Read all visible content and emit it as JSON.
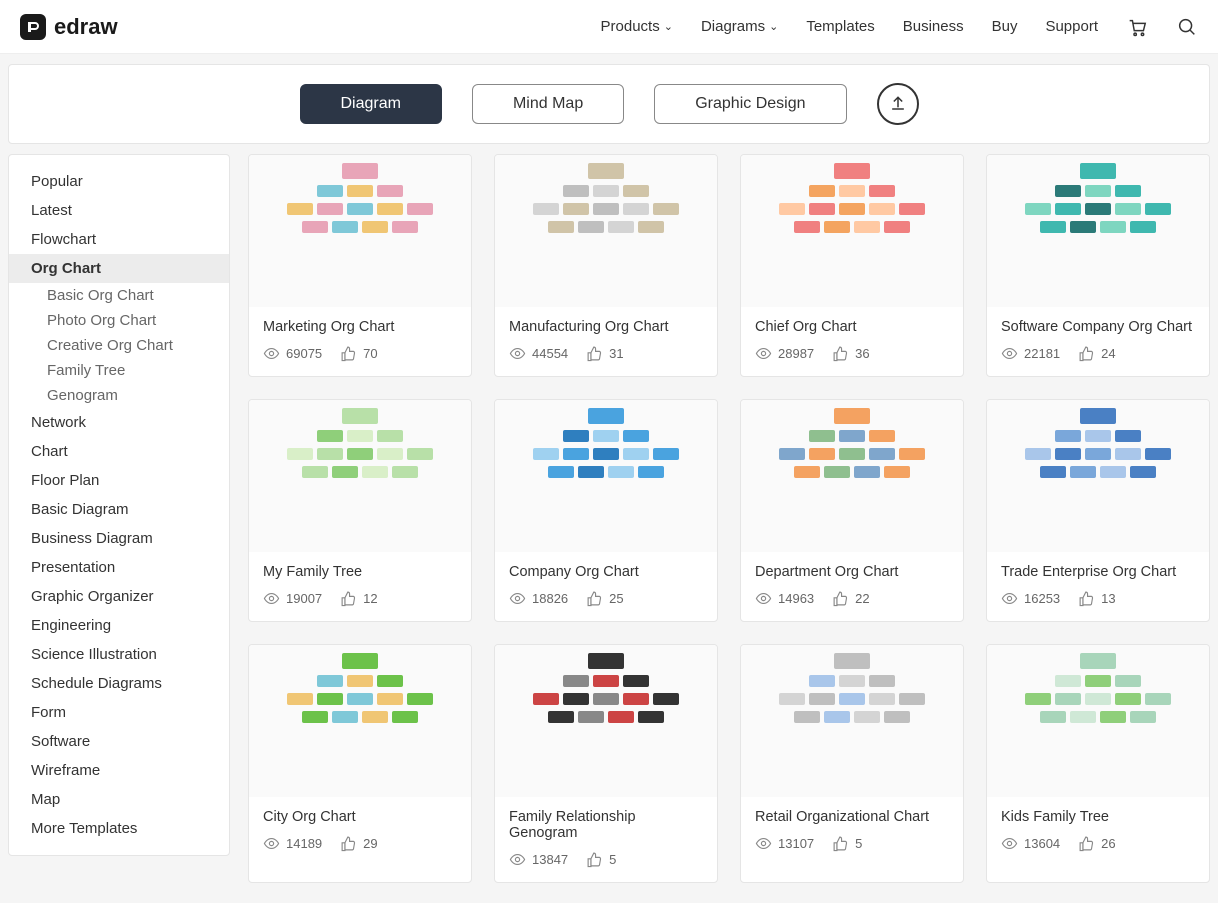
{
  "brand": {
    "name": "edraw"
  },
  "nav": {
    "items": [
      "Products",
      "Diagrams",
      "Templates",
      "Business",
      "Buy",
      "Support"
    ],
    "dropdown_flags": [
      true,
      true,
      false,
      false,
      false,
      false
    ]
  },
  "toolbar": {
    "tabs": [
      "Diagram",
      "Mind Map",
      "Graphic Design"
    ]
  },
  "sidebar": {
    "items": [
      "Popular",
      "Latest",
      "Flowchart",
      "Org Chart",
      "Network",
      "Chart",
      "Floor Plan",
      "Basic Diagram",
      "Business Diagram",
      "Presentation",
      "Graphic Organizer",
      "Engineering",
      "Science Illustration",
      "Schedule Diagrams",
      "Form",
      "Software",
      "Wireframe",
      "Map",
      "More Templates"
    ],
    "active_index": 3,
    "subitems": [
      "Basic Org Chart",
      "Photo Org Chart",
      "Creative Org Chart",
      "Family Tree",
      "Genogram"
    ]
  },
  "templates": [
    {
      "title": "Marketing Org Chart",
      "views": "69075",
      "likes": "70",
      "palette": [
        "#e8a5b8",
        "#7fc8d8",
        "#f0c674"
      ]
    },
    {
      "title": "Manufacturing Org Chart",
      "views": "44554",
      "likes": "31",
      "palette": [
        "#d0c4a8",
        "#bfbfbf",
        "#d4d4d4"
      ]
    },
    {
      "title": "Chief Org Chart",
      "views": "28987",
      "likes": "36",
      "palette": [
        "#f08080",
        "#f4a460",
        "#ffc9a3"
      ]
    },
    {
      "title": "Software Company Org Chart",
      "views": "22181",
      "likes": "24",
      "palette": [
        "#3fb8af",
        "#2b7a78",
        "#7ed6c0"
      ]
    },
    {
      "title": "My Family Tree",
      "views": "19007",
      "likes": "12",
      "palette": [
        "#b8e0a8",
        "#8fcf7a",
        "#d9efc8"
      ]
    },
    {
      "title": "Company Org Chart",
      "views": "18826",
      "likes": "25",
      "palette": [
        "#4aa3df",
        "#2f7fbf",
        "#9fd1f0"
      ]
    },
    {
      "title": "Department Org Chart",
      "views": "14963",
      "likes": "22",
      "palette": [
        "#f4a261",
        "#8fbf8f",
        "#7fa6cc"
      ]
    },
    {
      "title": "Trade Enterprise Org Chart",
      "views": "16253",
      "likes": "13",
      "palette": [
        "#4a80c4",
        "#7aa7da",
        "#a9c6ea"
      ]
    },
    {
      "title": "City Org Chart",
      "views": "14189",
      "likes": "29",
      "palette": [
        "#6cc24a",
        "#7fc8d8",
        "#f0c674"
      ]
    },
    {
      "title": "Family Relationship Genogram",
      "views": "13847",
      "likes": "5",
      "palette": [
        "#333333",
        "#888888",
        "#cc4444"
      ]
    },
    {
      "title": "Retail Organizational Chart",
      "views": "13107",
      "likes": "5",
      "palette": [
        "#bfbfbf",
        "#a9c6ea",
        "#d4d4d4"
      ]
    },
    {
      "title": "Kids Family Tree",
      "views": "13604",
      "likes": "26",
      "palette": [
        "#a8d5ba",
        "#cfe8d6",
        "#8fcf7a"
      ]
    }
  ]
}
